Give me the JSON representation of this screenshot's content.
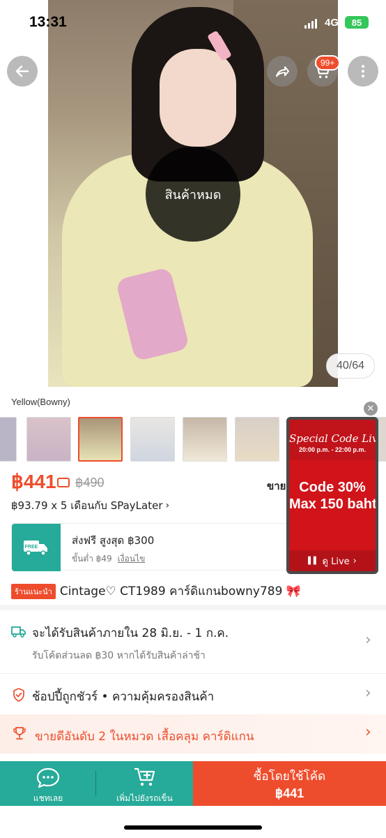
{
  "status_bar": {
    "time": "13:31",
    "network": "4G",
    "battery": "85"
  },
  "header": {
    "cart_badge": "99+"
  },
  "gallery": {
    "sold_out_label": "สินค้าหมด",
    "counter": "40/64"
  },
  "variant": {
    "selected_label": "Yellow(Bowny)"
  },
  "price": {
    "current": "฿441",
    "original": "฿490",
    "sold_label": "ขายแ",
    "installment": "฿93.79 x 5 เดือนกับ SPayLater"
  },
  "shipping": {
    "free_badge": "FREE",
    "title": "ส่งฟรี สูงสุด ฿300",
    "minimum": "ขั้นต่ำ ฿49",
    "conditions_link": "เงื่อนไข"
  },
  "live_banner": {
    "heading": "Special Code Live",
    "time": "20:00 p.m. - 22:00 p.m.",
    "code_line1": "Code 30%",
    "code_line2": "Max 150 baht",
    "button": "ดู Live"
  },
  "product": {
    "shop_badge": "ร้านแนะนำ",
    "title": "Cintage♡ CT1989 คาร์ดิแกนbowny789 🎀"
  },
  "delivery": {
    "title": "จะได้รับสินค้าภายใน 28 มิ.ย. - 1 ก.ค.",
    "subtitle": "รับโค้ดส่วนลด ฿30 หากได้รับสินค้าล่าช้า"
  },
  "guarantee": {
    "text": "ช้อปปี้ถูกชัวร์ • ความคุ้มครองสินค้า"
  },
  "best_seller": {
    "text": "ขายดีอันดับ 2 ในหมวด เสื้อคลุม คาร์ดิแกน"
  },
  "bottom_bar": {
    "chat_label": "แชทเลย",
    "add_cart_label": "เพิ่มไปยังรถเข็น",
    "buy_label": "ซื้อโดยใช้โค้ด",
    "buy_price": "฿441"
  },
  "colors": {
    "accent": "#ee4d2d",
    "teal": "#26aa99",
    "live_red": "#d0141a"
  }
}
